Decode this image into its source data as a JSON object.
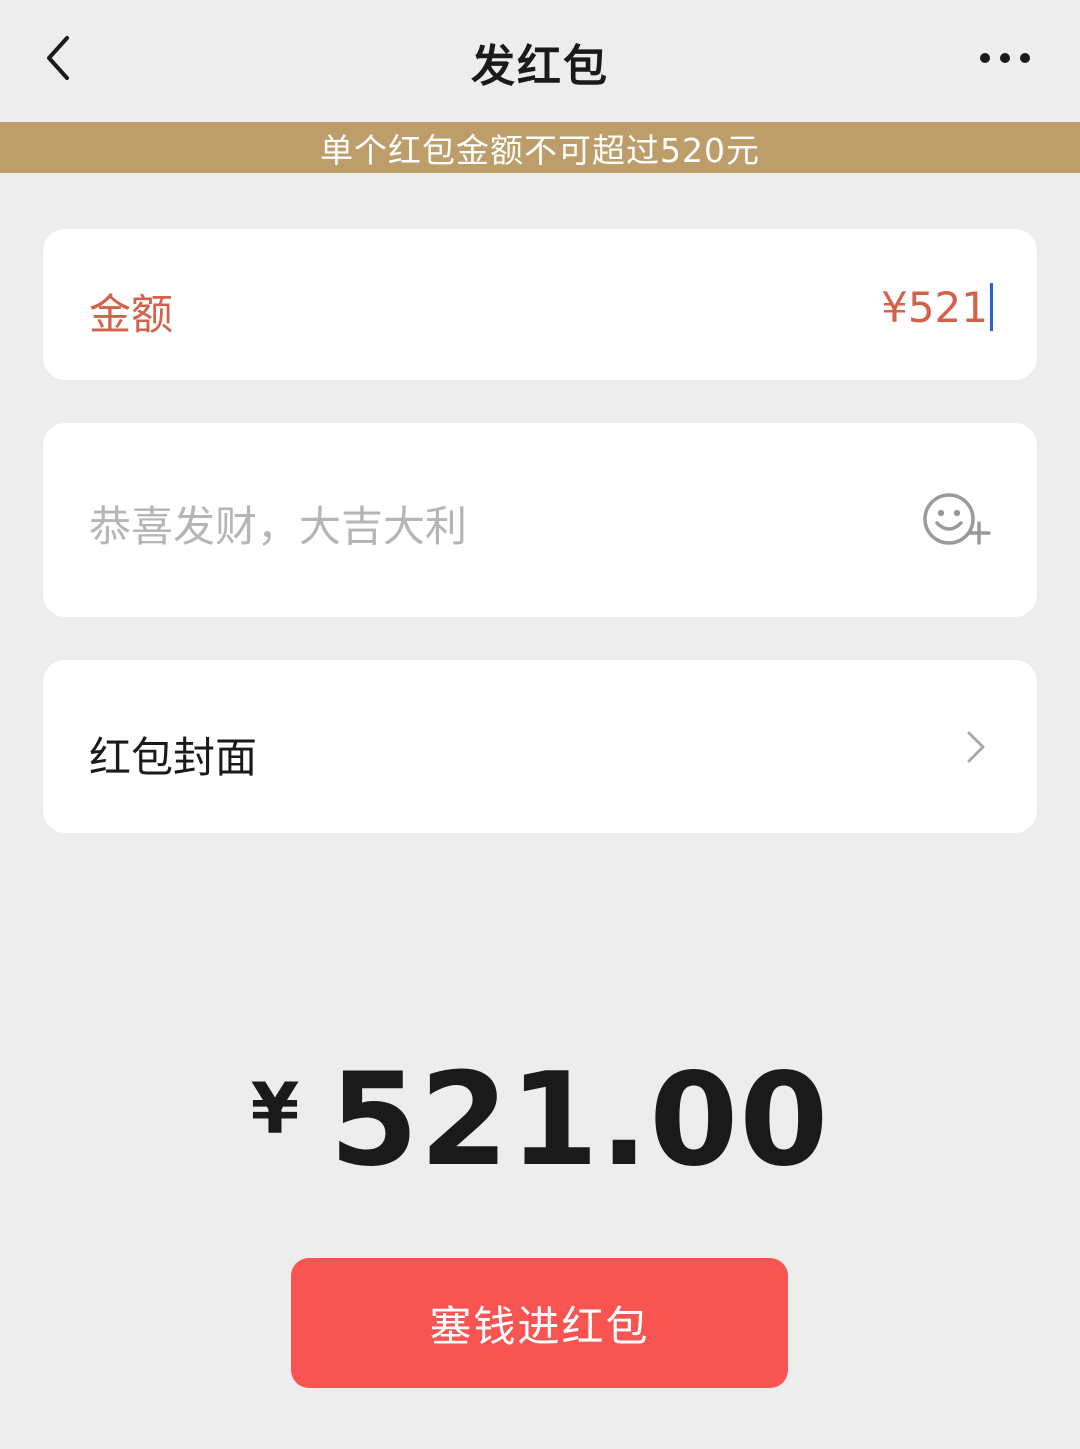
{
  "header": {
    "title": "发红包"
  },
  "banner": {
    "text": "单个红包金额不可超过520元"
  },
  "amount": {
    "label": "金额",
    "value": "¥521"
  },
  "greeting": {
    "placeholder": "恭喜发财，大吉大利"
  },
  "cover": {
    "label": "红包封面"
  },
  "total": {
    "currency": "¥",
    "value": "521.00"
  },
  "send_button": {
    "label": "塞钱进红包"
  },
  "icons": {
    "back": "chevron-left-icon",
    "more": "more-dots-icon",
    "emoji": "emoji-add-icon",
    "cover_arrow": "chevron-right-icon"
  },
  "colors": {
    "banner": "#bd9d69",
    "amount_text": "#d4624a",
    "button": "#f75452",
    "background": "#ededed"
  }
}
